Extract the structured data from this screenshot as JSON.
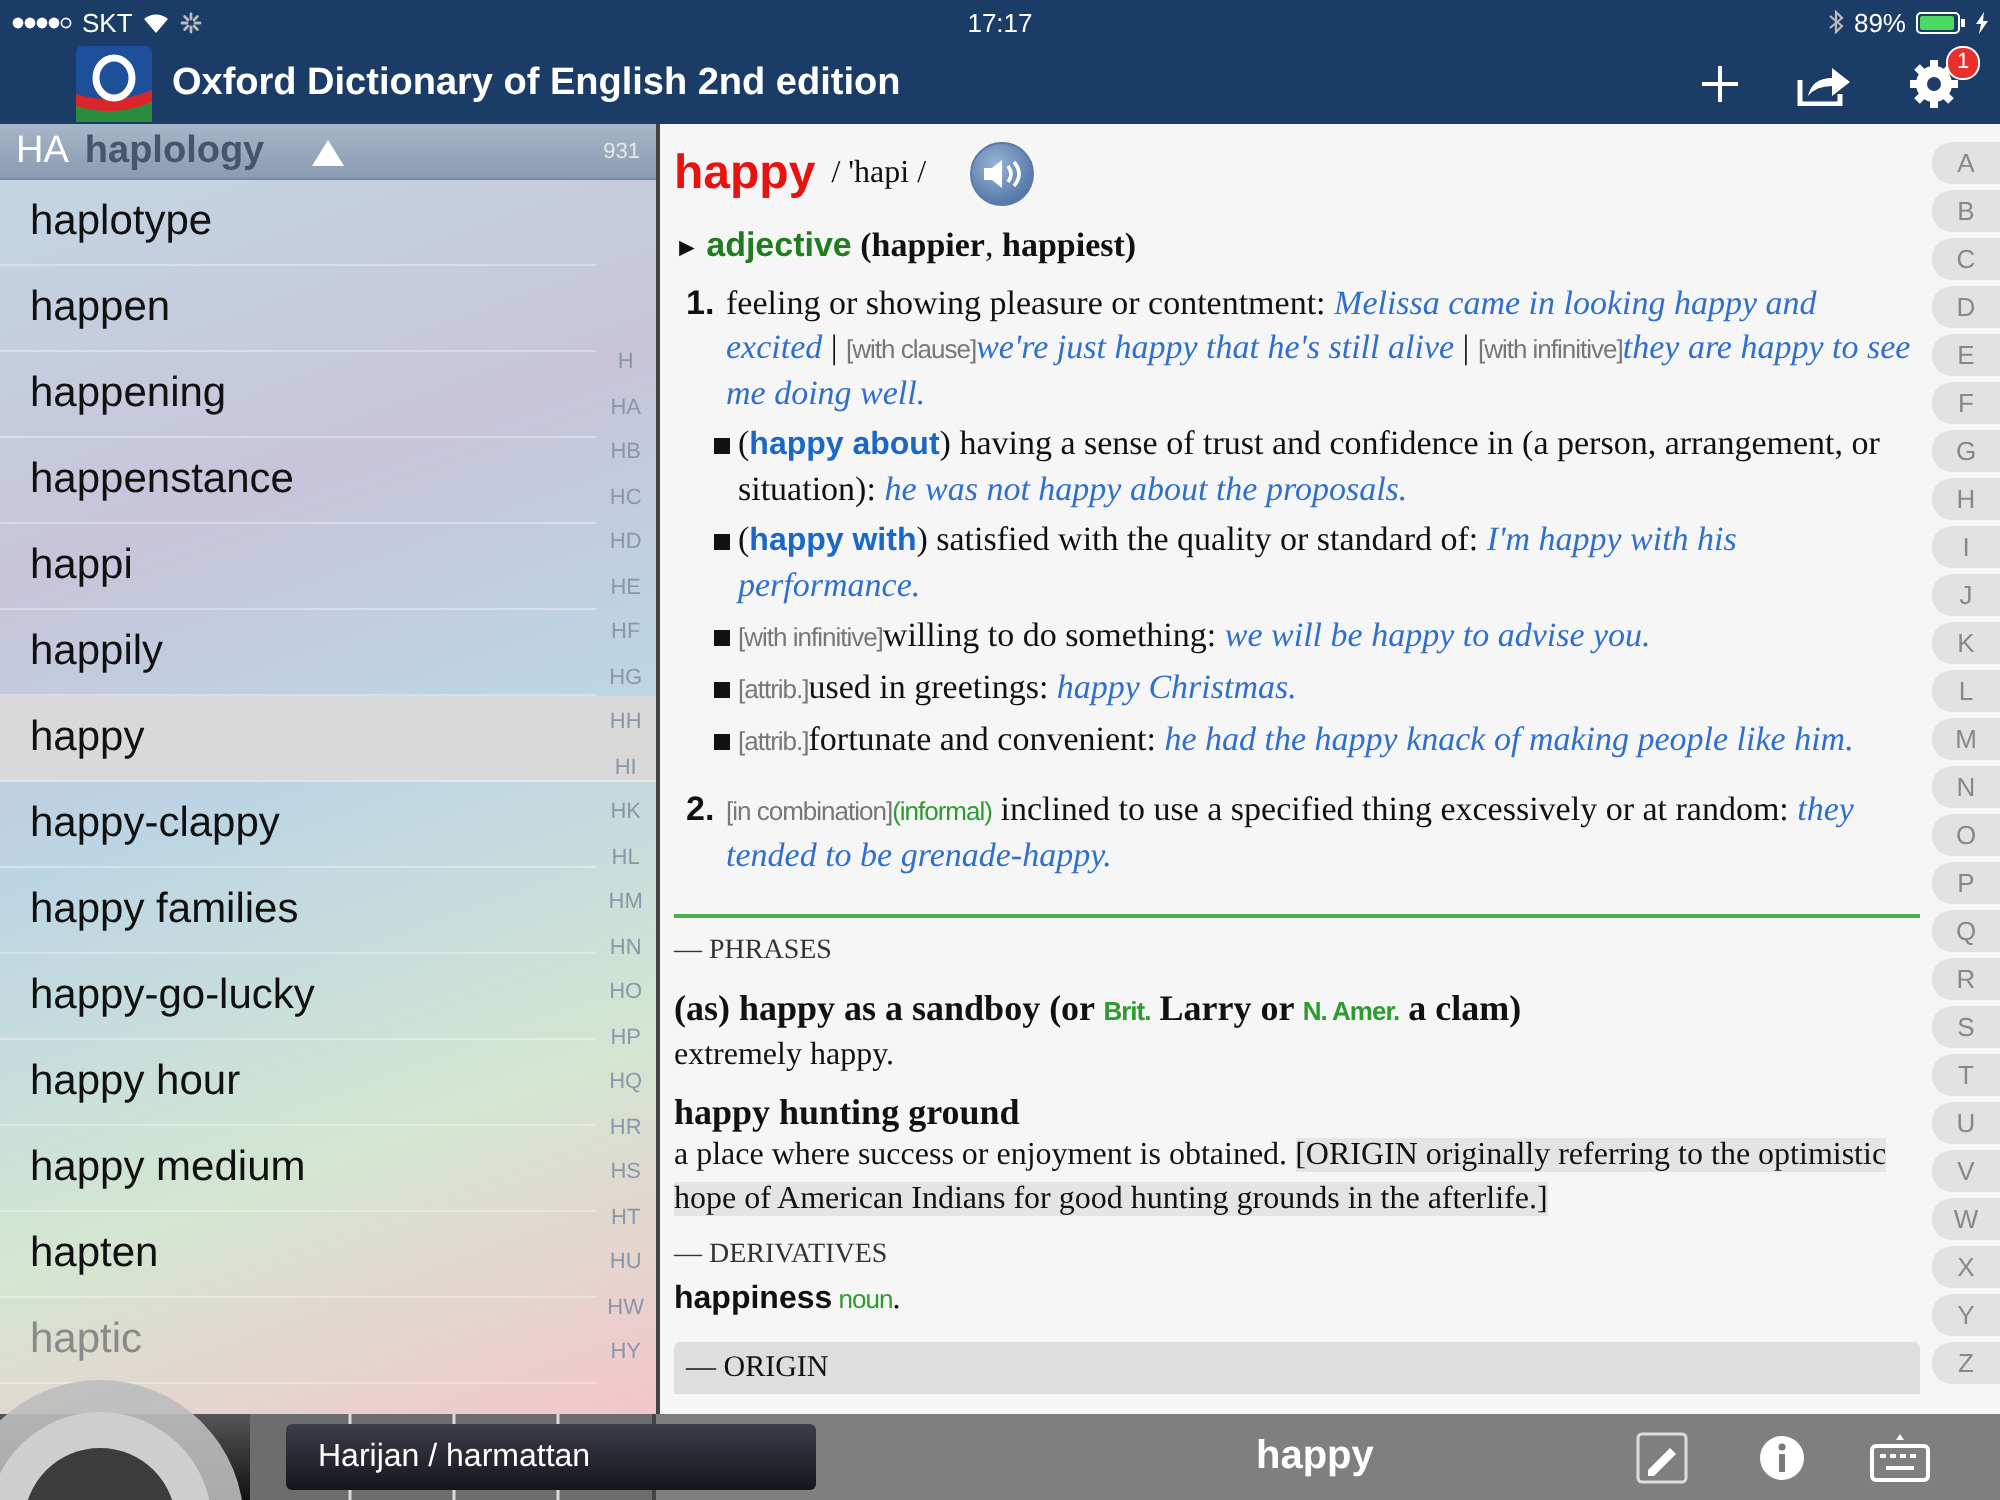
{
  "status_bar": {
    "carrier": "SKT",
    "time": "17:17",
    "battery": "89%"
  },
  "app_bar": {
    "title": "Oxford Dictionary of English 2nd edition",
    "settings_badge": "1"
  },
  "word_list": {
    "section": "HA",
    "ghost_word": "haplology",
    "count": "931",
    "items": [
      {
        "text": "haplotype",
        "selected": false,
        "dimmed": false
      },
      {
        "text": "happen",
        "selected": false,
        "dimmed": false
      },
      {
        "text": "happening",
        "selected": false,
        "dimmed": false
      },
      {
        "text": "happenstance",
        "selected": false,
        "dimmed": false
      },
      {
        "text": "happi",
        "selected": false,
        "dimmed": false
      },
      {
        "text": "happily",
        "selected": false,
        "dimmed": false
      },
      {
        "text": "happy",
        "selected": true,
        "dimmed": false
      },
      {
        "text": "happy-clappy",
        "selected": false,
        "dimmed": false
      },
      {
        "text": "happy families",
        "selected": false,
        "dimmed": false
      },
      {
        "text": "happy-go-lucky",
        "selected": false,
        "dimmed": false
      },
      {
        "text": "happy hour",
        "selected": false,
        "dimmed": false
      },
      {
        "text": "happy medium",
        "selected": false,
        "dimmed": false
      },
      {
        "text": "hapten",
        "selected": false,
        "dimmed": false
      },
      {
        "text": "haptic",
        "selected": false,
        "dimmed": true
      }
    ],
    "index": [
      "H",
      "HA",
      "HB",
      "HC",
      "HD",
      "HE",
      "HF",
      "HG",
      "HH",
      "HI",
      "HK",
      "HL",
      "HM",
      "HN",
      "HO",
      "HP",
      "HQ",
      "HR",
      "HS",
      "HT",
      "HU",
      "HW",
      "HY"
    ]
  },
  "scrub_tooltip": "Harijan / harmattan",
  "entry": {
    "headword": "happy",
    "pronunciation": "/ 'hapi /",
    "pos_line": [
      {
        "kind": "marker",
        "text": "► "
      },
      {
        "kind": "pos",
        "text": "adjective"
      },
      {
        "kind": "bold",
        "text": " (happier"
      },
      {
        "kind": "plain",
        "text": ", "
      },
      {
        "kind": "bold",
        "text": "happiest)"
      }
    ],
    "senses": [
      {
        "number": "1.",
        "segments": [
          {
            "kind": "plain",
            "text": "feeling or showing pleasure or contentment: "
          },
          {
            "kind": "example",
            "text": "Melissa came in looking happy and excited"
          },
          {
            "kind": "plain",
            "text": " | "
          },
          {
            "kind": "label",
            "text": "[with clause]"
          },
          {
            "kind": "example",
            "text": "we're just happy that he's still alive"
          },
          {
            "kind": "plain",
            "text": " | "
          },
          {
            "kind": "label",
            "text": "[with infinitive]"
          },
          {
            "kind": "example",
            "text": "they are happy to see me doing well."
          }
        ],
        "subsenses": [
          {
            "segments": [
              {
                "kind": "plain",
                "text": "("
              },
              {
                "kind": "phrase",
                "text": "happy about"
              },
              {
                "kind": "plain",
                "text": ") having a sense of trust and confidence in (a person, arrangement, or situation): "
              },
              {
                "kind": "example",
                "text": "he was not happy about the proposals."
              }
            ]
          },
          {
            "segments": [
              {
                "kind": "plain",
                "text": "("
              },
              {
                "kind": "phrase",
                "text": "happy with"
              },
              {
                "kind": "plain",
                "text": ") satisfied with the quality or standard of: "
              },
              {
                "kind": "example",
                "text": "I'm happy with his performance."
              }
            ]
          },
          {
            "segments": [
              {
                "kind": "label",
                "text": "[with infinitive]"
              },
              {
                "kind": "plain",
                "text": "willing to do something: "
              },
              {
                "kind": "example",
                "text": "we will be happy to advise you."
              }
            ]
          },
          {
            "segments": [
              {
                "kind": "label",
                "text": "[attrib.]"
              },
              {
                "kind": "plain",
                "text": "used in greetings: "
              },
              {
                "kind": "example",
                "text": "happy Christmas."
              }
            ]
          },
          {
            "segments": [
              {
                "kind": "label",
                "text": "[attrib.]"
              },
              {
                "kind": "plain",
                "text": "fortunate and convenient: "
              },
              {
                "kind": "example",
                "text": "he had the happy knack of making people like him."
              }
            ]
          }
        ]
      },
      {
        "number": "2.",
        "segments": [
          {
            "kind": "label",
            "text": "[in combination]"
          },
          {
            "kind": "register",
            "text": "(informal)"
          },
          {
            "kind": "plain",
            "text": " inclined to use a specified thing excessively or at random: "
          },
          {
            "kind": "example",
            "text": "they tended to be grenade-happy."
          }
        ]
      }
    ],
    "sections": [
      {
        "kind": "heading",
        "segments": [
          {
            "kind": "plain",
            "text": "— PHRASES"
          }
        ]
      },
      {
        "kind": "headline",
        "segments": [
          {
            "kind": "bold",
            "text": "(as) happy as a sandboy (or "
          },
          {
            "kind": "region",
            "text": "Brit."
          },
          {
            "kind": "bold",
            "text": " Larry or "
          },
          {
            "kind": "region",
            "text": "N. Amer."
          },
          {
            "kind": "bold",
            "text": " a clam)"
          }
        ]
      },
      {
        "kind": "text",
        "segments": [
          {
            "kind": "plain",
            "text": "extremely happy."
          }
        ]
      },
      {
        "kind": "headline",
        "segments": [
          {
            "kind": "bold",
            "text": "happy hunting ground"
          }
        ]
      },
      {
        "kind": "text",
        "segments": [
          {
            "kind": "plain",
            "text": "a place where success or enjoyment is obtained. "
          },
          {
            "kind": "origin",
            "text": "[ORIGIN  originally referring to the optimistic hope of American Indians for good hunting grounds in the afterlife.]"
          }
        ]
      },
      {
        "kind": "heading",
        "segments": [
          {
            "kind": "plain",
            "text": "— DERIVATIVES"
          }
        ]
      },
      {
        "kind": "text",
        "segments": [
          {
            "kind": "sansbold",
            "text": "happiness"
          },
          {
            "kind": "region",
            "text": " noun"
          },
          {
            "kind": "plain",
            "text": "."
          }
        ]
      },
      {
        "kind": "boxed_heading",
        "segments": [
          {
            "kind": "plain",
            "text": "— ORIGIN"
          }
        ]
      }
    ]
  },
  "alphabet": [
    "A",
    "B",
    "C",
    "D",
    "E",
    "F",
    "G",
    "H",
    "I",
    "J",
    "K",
    "L",
    "M",
    "N",
    "O",
    "P",
    "Q",
    "R",
    "S",
    "T",
    "U",
    "V",
    "W",
    "X",
    "Y",
    "Z"
  ],
  "bottom_bar": {
    "current_word": "happy"
  }
}
